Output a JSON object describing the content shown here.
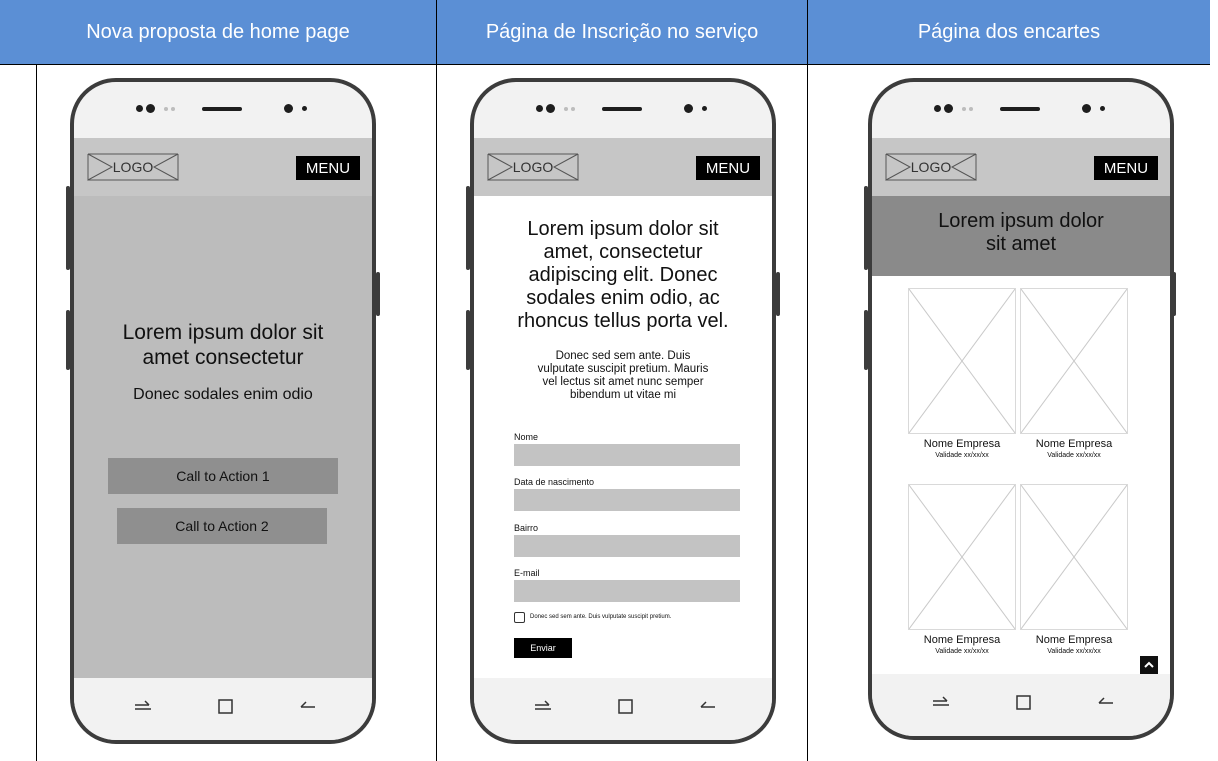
{
  "columns": [
    {
      "header": "Nova proposta de home page"
    },
    {
      "header": "Página de Inscrição no serviço"
    },
    {
      "header": "Página dos encartes"
    }
  ],
  "colors": {
    "header_bg": "#5b8fd5",
    "app_bar": "#c6c6c6",
    "home_bg": "#bcbcbc",
    "cta_bg": "#8f8f8f",
    "banner_bg": "#8a8a8a",
    "field_bg": "#c3c3c3"
  },
  "common": {
    "logo": "LOGO",
    "menu": "MENU",
    "nav_icons": [
      "recent-apps-icon",
      "home-square-icon",
      "back-arrow-icon"
    ]
  },
  "home": {
    "title_line1": "Lorem ipsum dolor sit",
    "title_line2": "amet consectetur",
    "subtitle": "Donec sodales enim odio",
    "cta1": "Call to Action 1",
    "cta2": "Call to Action 2"
  },
  "signup": {
    "title_lines": [
      "Lorem ipsum dolor sit",
      "amet, consectetur",
      "adipiscing elit. Donec",
      "sodales enim odio, ac",
      "rhoncus tellus porta vel."
    ],
    "desc_lines": [
      "Donec sed sem ante. Duis",
      "vulputate suscipit pretium. Mauris",
      "vel lectus sit amet nunc semper",
      "bibendum ut vitae mi"
    ],
    "fields": [
      "Nome",
      "Data de nascimento",
      "Bairro",
      "E-mail"
    ],
    "checkbox_label": "Donec sed sem ante. Duis vulputate suscipit pretium.",
    "submit": "Enviar"
  },
  "encartes": {
    "banner_line1": "Lorem ipsum dolor",
    "banner_line2": "sit amet",
    "cards": [
      {
        "name": "Nome Empresa",
        "validity": "Validade xx/xx/xx"
      },
      {
        "name": "Nome Empresa",
        "validity": "Validade xx/xx/xx"
      },
      {
        "name": "Nome Empresa",
        "validity": "Validade xx/xx/xx"
      },
      {
        "name": "Nome Empresa",
        "validity": "Validade xx/xx/xx"
      }
    ]
  }
}
